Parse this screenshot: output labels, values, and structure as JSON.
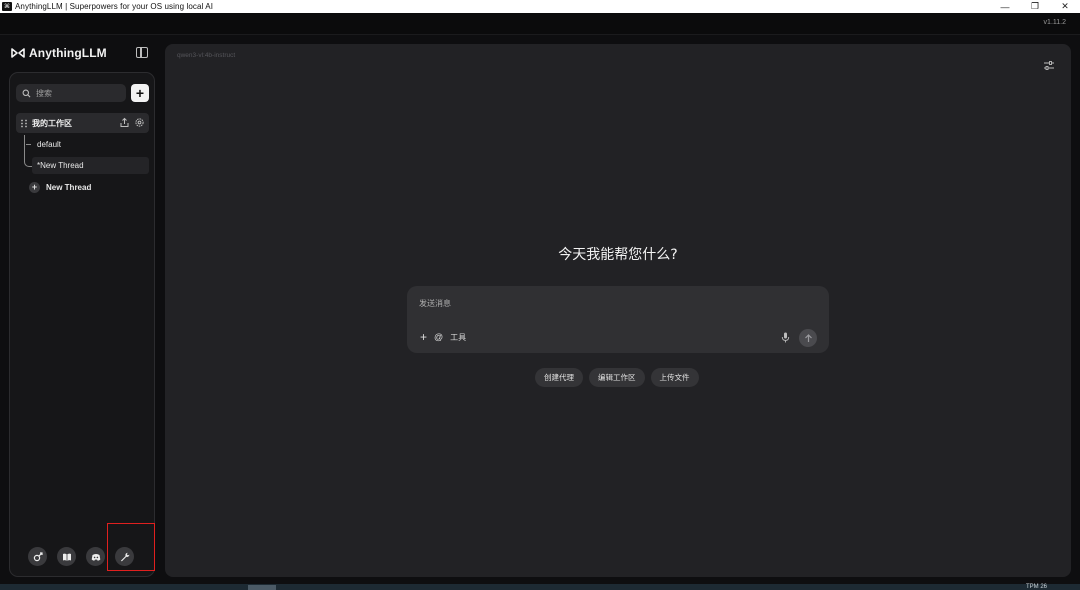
{
  "window": {
    "title": "AnythingLLM | Superpowers for your OS using local AI",
    "app_icon_glyph": "⌘",
    "minimize_glyph": "—",
    "restore_glyph": "❐",
    "close_glyph": "✕"
  },
  "app": {
    "version": "v1.11.2",
    "brand": "AnythingLLM"
  },
  "sidebar": {
    "search_placeholder": "搜索",
    "new_workspace_label": "+",
    "workspace": {
      "name": "我的工作区",
      "threads": [
        {
          "label": "default"
        },
        {
          "label": "*New Thread"
        }
      ]
    },
    "new_thread": {
      "plus": "+",
      "label": "New Thread"
    },
    "footer_icons": [
      "agent-icon",
      "book-icon",
      "discord-icon",
      "wrench-icon"
    ]
  },
  "main": {
    "model_name": "qwen3-vl:4b-instruct",
    "greeting": "今天我能帮您什么?",
    "composer": {
      "placeholder": "发送消息",
      "plus": "+",
      "at": "@",
      "tools_label": "工具"
    },
    "quick_actions": [
      {
        "label": "创建代理"
      },
      {
        "label": "编辑工作区"
      },
      {
        "label": "上传文件"
      }
    ]
  },
  "taskbar": {
    "clock": "TPM 26"
  },
  "colors": {
    "background": "#0e0e10",
    "panel": "#222225",
    "sidebar": "#161618",
    "highlight": "#e0201f"
  }
}
